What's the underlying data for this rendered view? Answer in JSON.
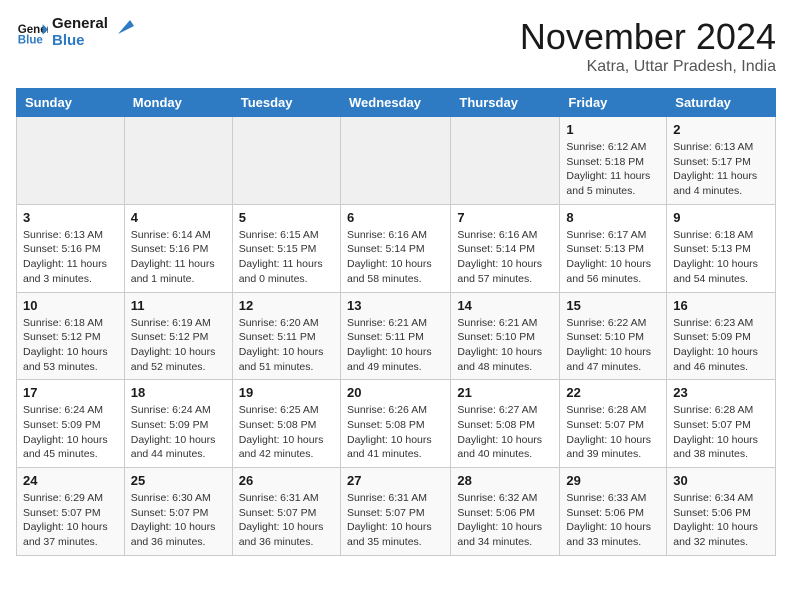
{
  "header": {
    "logo_line1": "General",
    "logo_line2": "Blue",
    "month": "November 2024",
    "location": "Katra, Uttar Pradesh, India"
  },
  "weekdays": [
    "Sunday",
    "Monday",
    "Tuesday",
    "Wednesday",
    "Thursday",
    "Friday",
    "Saturday"
  ],
  "weeks": [
    [
      {
        "day": "",
        "info": ""
      },
      {
        "day": "",
        "info": ""
      },
      {
        "day": "",
        "info": ""
      },
      {
        "day": "",
        "info": ""
      },
      {
        "day": "",
        "info": ""
      },
      {
        "day": "1",
        "info": "Sunrise: 6:12 AM\nSunset: 5:18 PM\nDaylight: 11 hours and 5 minutes."
      },
      {
        "day": "2",
        "info": "Sunrise: 6:13 AM\nSunset: 5:17 PM\nDaylight: 11 hours and 4 minutes."
      }
    ],
    [
      {
        "day": "3",
        "info": "Sunrise: 6:13 AM\nSunset: 5:16 PM\nDaylight: 11 hours and 3 minutes."
      },
      {
        "day": "4",
        "info": "Sunrise: 6:14 AM\nSunset: 5:16 PM\nDaylight: 11 hours and 1 minute."
      },
      {
        "day": "5",
        "info": "Sunrise: 6:15 AM\nSunset: 5:15 PM\nDaylight: 11 hours and 0 minutes."
      },
      {
        "day": "6",
        "info": "Sunrise: 6:16 AM\nSunset: 5:14 PM\nDaylight: 10 hours and 58 minutes."
      },
      {
        "day": "7",
        "info": "Sunrise: 6:16 AM\nSunset: 5:14 PM\nDaylight: 10 hours and 57 minutes."
      },
      {
        "day": "8",
        "info": "Sunrise: 6:17 AM\nSunset: 5:13 PM\nDaylight: 10 hours and 56 minutes."
      },
      {
        "day": "9",
        "info": "Sunrise: 6:18 AM\nSunset: 5:13 PM\nDaylight: 10 hours and 54 minutes."
      }
    ],
    [
      {
        "day": "10",
        "info": "Sunrise: 6:18 AM\nSunset: 5:12 PM\nDaylight: 10 hours and 53 minutes."
      },
      {
        "day": "11",
        "info": "Sunrise: 6:19 AM\nSunset: 5:12 PM\nDaylight: 10 hours and 52 minutes."
      },
      {
        "day": "12",
        "info": "Sunrise: 6:20 AM\nSunset: 5:11 PM\nDaylight: 10 hours and 51 minutes."
      },
      {
        "day": "13",
        "info": "Sunrise: 6:21 AM\nSunset: 5:11 PM\nDaylight: 10 hours and 49 minutes."
      },
      {
        "day": "14",
        "info": "Sunrise: 6:21 AM\nSunset: 5:10 PM\nDaylight: 10 hours and 48 minutes."
      },
      {
        "day": "15",
        "info": "Sunrise: 6:22 AM\nSunset: 5:10 PM\nDaylight: 10 hours and 47 minutes."
      },
      {
        "day": "16",
        "info": "Sunrise: 6:23 AM\nSunset: 5:09 PM\nDaylight: 10 hours and 46 minutes."
      }
    ],
    [
      {
        "day": "17",
        "info": "Sunrise: 6:24 AM\nSunset: 5:09 PM\nDaylight: 10 hours and 45 minutes."
      },
      {
        "day": "18",
        "info": "Sunrise: 6:24 AM\nSunset: 5:09 PM\nDaylight: 10 hours and 44 minutes."
      },
      {
        "day": "19",
        "info": "Sunrise: 6:25 AM\nSunset: 5:08 PM\nDaylight: 10 hours and 42 minutes."
      },
      {
        "day": "20",
        "info": "Sunrise: 6:26 AM\nSunset: 5:08 PM\nDaylight: 10 hours and 41 minutes."
      },
      {
        "day": "21",
        "info": "Sunrise: 6:27 AM\nSunset: 5:08 PM\nDaylight: 10 hours and 40 minutes."
      },
      {
        "day": "22",
        "info": "Sunrise: 6:28 AM\nSunset: 5:07 PM\nDaylight: 10 hours and 39 minutes."
      },
      {
        "day": "23",
        "info": "Sunrise: 6:28 AM\nSunset: 5:07 PM\nDaylight: 10 hours and 38 minutes."
      }
    ],
    [
      {
        "day": "24",
        "info": "Sunrise: 6:29 AM\nSunset: 5:07 PM\nDaylight: 10 hours and 37 minutes."
      },
      {
        "day": "25",
        "info": "Sunrise: 6:30 AM\nSunset: 5:07 PM\nDaylight: 10 hours and 36 minutes."
      },
      {
        "day": "26",
        "info": "Sunrise: 6:31 AM\nSunset: 5:07 PM\nDaylight: 10 hours and 36 minutes."
      },
      {
        "day": "27",
        "info": "Sunrise: 6:31 AM\nSunset: 5:07 PM\nDaylight: 10 hours and 35 minutes."
      },
      {
        "day": "28",
        "info": "Sunrise: 6:32 AM\nSunset: 5:06 PM\nDaylight: 10 hours and 34 minutes."
      },
      {
        "day": "29",
        "info": "Sunrise: 6:33 AM\nSunset: 5:06 PM\nDaylight: 10 hours and 33 minutes."
      },
      {
        "day": "30",
        "info": "Sunrise: 6:34 AM\nSunset: 5:06 PM\nDaylight: 10 hours and 32 minutes."
      }
    ]
  ]
}
